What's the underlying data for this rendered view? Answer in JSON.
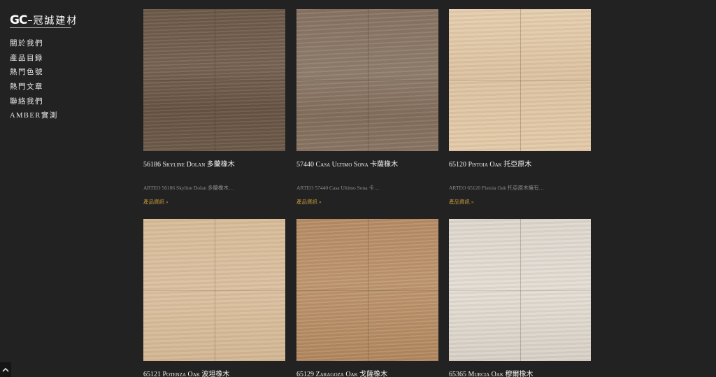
{
  "brand": {
    "mark": "GC",
    "name": "冠誠建材"
  },
  "nav": {
    "items": [
      {
        "label": "關於我們"
      },
      {
        "label": "產品目錄"
      },
      {
        "label": "熱門色號"
      },
      {
        "label": "熱門文章"
      },
      {
        "label": "聯絡我們"
      },
      {
        "label": "AMBER實測"
      }
    ]
  },
  "products": [
    {
      "title": "56186 Skyline Dolan 多蘭橡木",
      "desc": "ARTEO 56186 Skyline Dolan 多蘭橡木…",
      "more": "產品資訊 »",
      "color": "#735f4f"
    },
    {
      "title": "57440 Casa Ultimo Sona 卡薩橡木",
      "desc": "ARTEO 57440 Casa Ultimo Sona 卡…",
      "more": "產品資訊 »",
      "color": "#8c7867"
    },
    {
      "title": "65120 Pistoia Oak 托亞原木",
      "desc": "ARTEO 65120 Pistoia Oak 托亞原木擁有…",
      "more": "產品資訊 »",
      "color": "#e2c9a7"
    },
    {
      "title": "65121 Potenza Oak 波坦橡木",
      "desc": "",
      "more": "",
      "color": "#d8bc99"
    },
    {
      "title": "65129 Zaragoza Oak 戈薩橡木",
      "desc": "",
      "more": "",
      "color": "#bd946c"
    },
    {
      "title": "65365 Murcia Oak 穆爾橡木",
      "desc": "",
      "more": "",
      "color": "#dfd8cf"
    }
  ],
  "scroll_top": {
    "icon": "chevron-up-icon"
  }
}
